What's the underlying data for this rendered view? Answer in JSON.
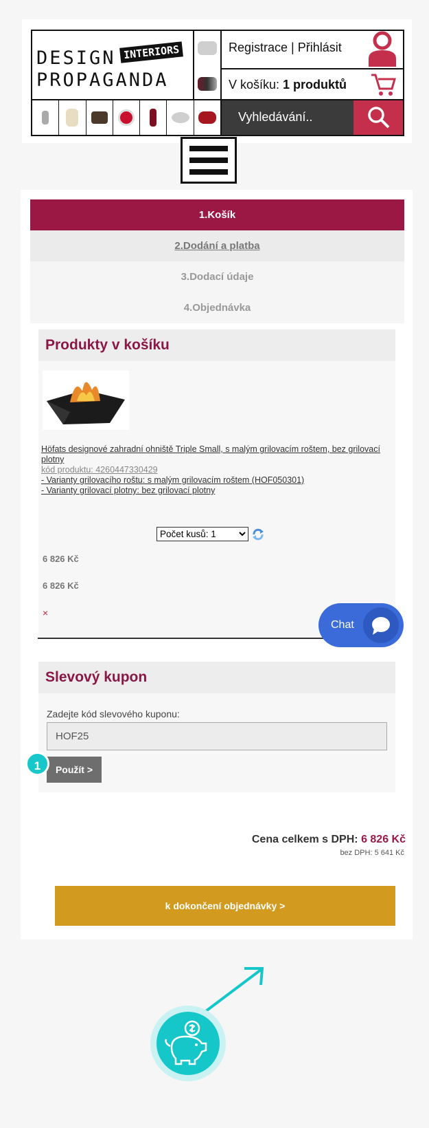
{
  "header": {
    "logo_line1": "DESIGN",
    "logo_line2": "PROPAGANDA",
    "logo_badge": "INTERIORS",
    "account_links": "Registrace | Přihlásit",
    "cart_prefix": "V košíku:",
    "cart_count": "1 produktů",
    "search_placeholder": "Vyhledávání..",
    "icons": [
      "user-icon",
      "cart-icon",
      "search-icon",
      "menu-icon"
    ]
  },
  "steps": [
    {
      "label": "1.Košík"
    },
    {
      "label": "2.Dodání a platba"
    },
    {
      "label": "3.Dodací údaje"
    },
    {
      "label": "4.Objednávka"
    }
  ],
  "cart": {
    "title": "Produkty v košíku",
    "product": {
      "name": "Höfats designové zahradní ohniště Triple Small, s malým grilovacím roštem, bez grilovací plotny",
      "code": "kód produktu: 4260447330429",
      "variant1": "- Varianty grilovacího roštu: s malým grilovacím roštem (HOF050301)",
      "variant2": "- Varianty grilovací plotny: bez grilovací plotny",
      "quantity_label": "Počet kusů: 1",
      "unit_price": "6 826 Kč",
      "total_price": "6 826 Kč",
      "remove": "×"
    }
  },
  "coupon": {
    "title": "Slevový kupon",
    "label": "Zadejte kód slevového kuponu:",
    "value": "HOF25",
    "button": "Použít >"
  },
  "summary": {
    "total_label": "Cena celkem s DPH:",
    "total_value": "6 826 Kč",
    "vat_label": "bez DPH: 5 641 Kč"
  },
  "checkout_button": "k dokončení objednávky >",
  "chat": {
    "label": "Chat"
  },
  "annotation": {
    "step_number": "1"
  },
  "colors": {
    "brand": "#9b1845",
    "checkout": "#d29a1f",
    "chat": "#3a6bd8",
    "annotation": "#16c7c9",
    "search_button": "#c4304b"
  }
}
